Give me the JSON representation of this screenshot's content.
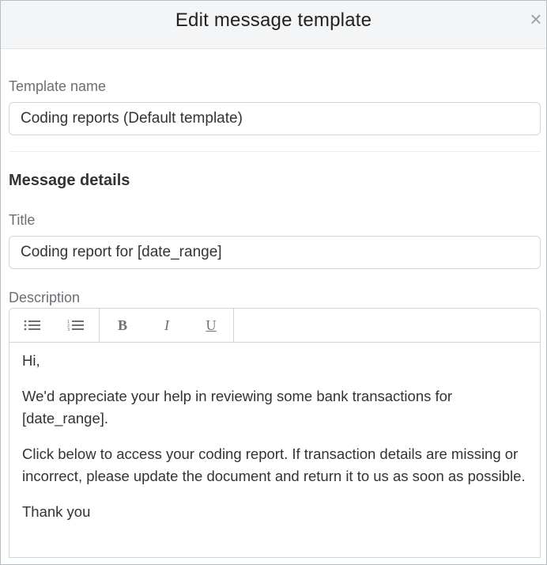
{
  "dialog": {
    "title": "Edit message template",
    "close_glyph": "×"
  },
  "template_name": {
    "label": "Template name",
    "value": "Coding reports (Default template)"
  },
  "message_details": {
    "section_title": "Message details",
    "title_label": "Title",
    "title_value": "Coding report for [date_range]",
    "description_label": "Description"
  },
  "toolbar": {
    "buttons": [
      {
        "name": "bullet-list",
        "icon": "bullet-list-icon"
      },
      {
        "name": "numbered-list",
        "icon": "numbered-list-icon"
      },
      {
        "name": "bold",
        "label": "B"
      },
      {
        "name": "italic",
        "label": "I"
      },
      {
        "name": "underline",
        "label": "U"
      }
    ]
  },
  "description": {
    "paragraphs": [
      "Hi,",
      "We'd appreciate your help in reviewing some bank transactions for [date_range].",
      "Click below to access your coding report. If transaction details are missing or incorrect, please update the document and return it to us as soon as possible.",
      "Thank you"
    ]
  }
}
